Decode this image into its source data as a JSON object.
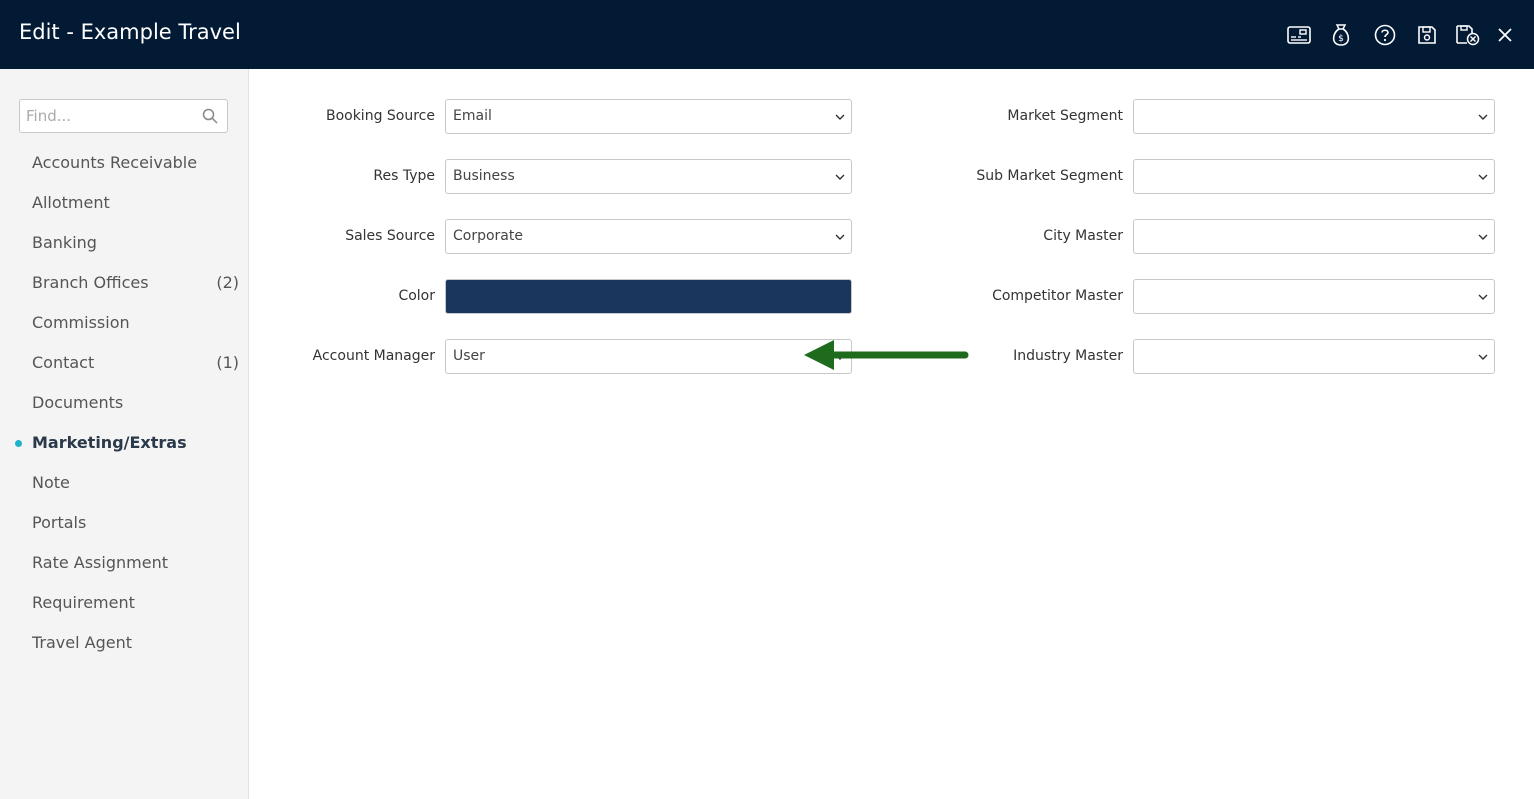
{
  "header": {
    "title": "Edit - Example Travel",
    "icons": [
      "card-icon",
      "money-bag-icon",
      "help-icon",
      "save-icon",
      "save-close-icon",
      "close-icon"
    ]
  },
  "sidebar": {
    "search_placeholder": "Find...",
    "items": [
      {
        "label": "Accounts Receivable",
        "count": ""
      },
      {
        "label": "Allotment",
        "count": ""
      },
      {
        "label": "Banking",
        "count": ""
      },
      {
        "label": "Branch Offices",
        "count": "(2)"
      },
      {
        "label": "Commission",
        "count": ""
      },
      {
        "label": "Contact",
        "count": "(1)"
      },
      {
        "label": "Documents",
        "count": ""
      },
      {
        "label": "Marketing/Extras",
        "count": "",
        "active": true
      },
      {
        "label": "Note",
        "count": ""
      },
      {
        "label": "Portals",
        "count": ""
      },
      {
        "label": "Rate Assignment",
        "count": ""
      },
      {
        "label": "Requirement",
        "count": ""
      },
      {
        "label": "Travel Agent",
        "count": ""
      }
    ]
  },
  "form": {
    "left": [
      {
        "label": "Booking Source",
        "value": "Email"
      },
      {
        "label": "Res Type",
        "value": "Business"
      },
      {
        "label": "Sales Source",
        "value": "Corporate"
      },
      {
        "label": "Color",
        "value": ""
      },
      {
        "label": "Account Manager",
        "value": "User"
      }
    ],
    "right": [
      {
        "label": "Market Segment",
        "value": ""
      },
      {
        "label": "Sub Market Segment",
        "value": ""
      },
      {
        "label": "City Master",
        "value": ""
      },
      {
        "label": "Competitor Master",
        "value": ""
      },
      {
        "label": "Industry Master",
        "value": ""
      }
    ]
  },
  "colors": {
    "header_bg": "#031a35",
    "color_swatch": "#1a365d",
    "active_dot": "#1fb3c9",
    "annotation_arrow": "#1e6b1e"
  }
}
